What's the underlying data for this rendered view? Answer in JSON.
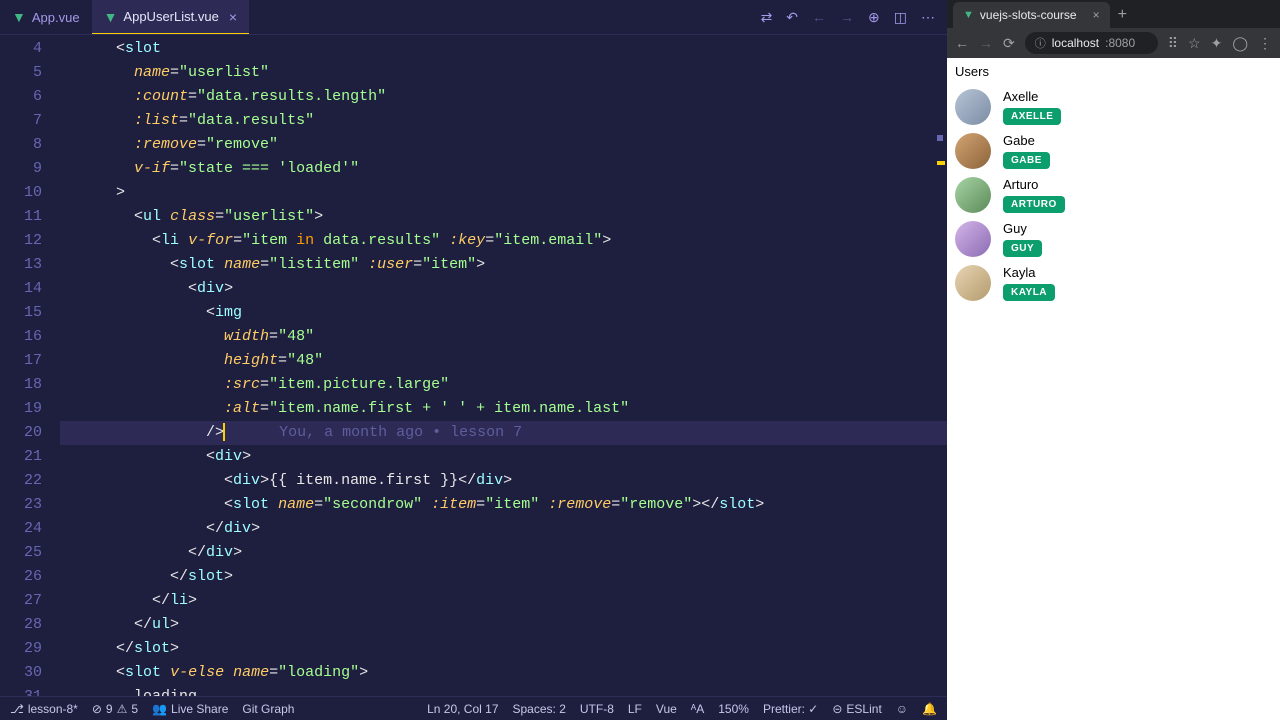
{
  "editor": {
    "tabs": [
      {
        "label": "App.vue",
        "active": false
      },
      {
        "label": "AppUserList.vue",
        "active": true
      }
    ],
    "gutter_start": 4,
    "gutter_end": 31,
    "code_lines": [
      {
        "indent": 2,
        "tokens": [
          [
            "punct",
            "<"
          ],
          [
            "tag-name",
            "slot"
          ]
        ]
      },
      {
        "indent": 3,
        "tokens": [
          [
            "attr",
            "name"
          ],
          [
            "punct",
            "="
          ],
          [
            "string",
            "\"userlist\""
          ]
        ]
      },
      {
        "indent": 3,
        "tokens": [
          [
            "attr",
            ":count"
          ],
          [
            "punct",
            "="
          ],
          [
            "string",
            "\"data.results.length\""
          ]
        ]
      },
      {
        "indent": 3,
        "tokens": [
          [
            "attr",
            ":list"
          ],
          [
            "punct",
            "="
          ],
          [
            "string",
            "\"data.results\""
          ]
        ]
      },
      {
        "indent": 3,
        "tokens": [
          [
            "attr",
            ":remove"
          ],
          [
            "punct",
            "="
          ],
          [
            "string",
            "\"remove\""
          ]
        ]
      },
      {
        "indent": 3,
        "tokens": [
          [
            "attr",
            "v-if"
          ],
          [
            "punct",
            "="
          ],
          [
            "string",
            "\"state === 'loaded'\""
          ]
        ]
      },
      {
        "indent": 2,
        "tokens": [
          [
            "punct",
            ">"
          ]
        ]
      },
      {
        "indent": 3,
        "tokens": [
          [
            "punct",
            "<"
          ],
          [
            "tag-name",
            "ul"
          ],
          [
            "text",
            " "
          ],
          [
            "attr",
            "class"
          ],
          [
            "punct",
            "="
          ],
          [
            "string",
            "\"userlist\""
          ],
          [
            "punct",
            ">"
          ]
        ]
      },
      {
        "indent": 4,
        "tokens": [
          [
            "punct",
            "<"
          ],
          [
            "tag-name",
            "li"
          ],
          [
            "text",
            " "
          ],
          [
            "attr",
            "v-for"
          ],
          [
            "punct",
            "="
          ],
          [
            "string",
            "\"item "
          ],
          [
            "operator",
            "in"
          ],
          [
            "string",
            " data.results\""
          ],
          [
            "text",
            " "
          ],
          [
            "attr",
            ":key"
          ],
          [
            "punct",
            "="
          ],
          [
            "string",
            "\"item.email\""
          ],
          [
            "punct",
            ">"
          ]
        ]
      },
      {
        "indent": 5,
        "tokens": [
          [
            "punct",
            "<"
          ],
          [
            "tag-name",
            "slot"
          ],
          [
            "text",
            " "
          ],
          [
            "attr",
            "name"
          ],
          [
            "punct",
            "="
          ],
          [
            "string",
            "\"listitem\""
          ],
          [
            "text",
            " "
          ],
          [
            "attr",
            ":user"
          ],
          [
            "punct",
            "="
          ],
          [
            "string",
            "\"item\""
          ],
          [
            "punct",
            ">"
          ]
        ]
      },
      {
        "indent": 6,
        "tokens": [
          [
            "punct",
            "<"
          ],
          [
            "tag-name",
            "div"
          ],
          [
            "punct",
            ">"
          ]
        ]
      },
      {
        "indent": 7,
        "tokens": [
          [
            "punct",
            "<"
          ],
          [
            "tag-name",
            "img"
          ]
        ]
      },
      {
        "indent": 8,
        "tokens": [
          [
            "attr",
            "width"
          ],
          [
            "punct",
            "="
          ],
          [
            "string",
            "\"48\""
          ]
        ]
      },
      {
        "indent": 8,
        "tokens": [
          [
            "attr",
            "height"
          ],
          [
            "punct",
            "="
          ],
          [
            "string",
            "\"48\""
          ]
        ]
      },
      {
        "indent": 8,
        "tokens": [
          [
            "attr",
            ":src"
          ],
          [
            "punct",
            "="
          ],
          [
            "string",
            "\"item.picture.large\""
          ]
        ]
      },
      {
        "indent": 8,
        "tokens": [
          [
            "attr",
            ":alt"
          ],
          [
            "punct",
            "="
          ],
          [
            "string",
            "\"item.name.first + ' ' + item.name.last\""
          ]
        ]
      },
      {
        "indent": 7,
        "tokens": [
          [
            "punct",
            "/>"
          ]
        ],
        "highlighted": true,
        "cursor": true,
        "blame": "You, a month ago • lesson 7"
      },
      {
        "indent": 7,
        "tokens": [
          [
            "punct",
            "<"
          ],
          [
            "tag-name",
            "div"
          ],
          [
            "punct",
            ">"
          ]
        ]
      },
      {
        "indent": 8,
        "tokens": [
          [
            "punct",
            "<"
          ],
          [
            "tag-name",
            "div"
          ],
          [
            "punct",
            ">"
          ],
          [
            "text",
            "{{ item.name.first }}"
          ],
          [
            "punct",
            "</"
          ],
          [
            "tag-name",
            "div"
          ],
          [
            "punct",
            ">"
          ]
        ]
      },
      {
        "indent": 8,
        "tokens": [
          [
            "punct",
            "<"
          ],
          [
            "tag-name",
            "slot"
          ],
          [
            "text",
            " "
          ],
          [
            "attr",
            "name"
          ],
          [
            "punct",
            "="
          ],
          [
            "string",
            "\"secondrow\""
          ],
          [
            "text",
            " "
          ],
          [
            "attr",
            ":item"
          ],
          [
            "punct",
            "="
          ],
          [
            "string",
            "\"item\""
          ],
          [
            "text",
            " "
          ],
          [
            "attr",
            ":remove"
          ],
          [
            "punct",
            "="
          ],
          [
            "string",
            "\"remove\""
          ],
          [
            "punct",
            "></"
          ],
          [
            "tag-name",
            "slot"
          ],
          [
            "punct",
            ">"
          ]
        ]
      },
      {
        "indent": 7,
        "tokens": [
          [
            "punct",
            "</"
          ],
          [
            "tag-name",
            "div"
          ],
          [
            "punct",
            ">"
          ]
        ]
      },
      {
        "indent": 6,
        "tokens": [
          [
            "punct",
            "</"
          ],
          [
            "tag-name",
            "div"
          ],
          [
            "punct",
            ">"
          ]
        ]
      },
      {
        "indent": 5,
        "tokens": [
          [
            "punct",
            "</"
          ],
          [
            "tag-name",
            "slot"
          ],
          [
            "punct",
            ">"
          ]
        ]
      },
      {
        "indent": 4,
        "tokens": [
          [
            "punct",
            "</"
          ],
          [
            "tag-name",
            "li"
          ],
          [
            "punct",
            ">"
          ]
        ]
      },
      {
        "indent": 3,
        "tokens": [
          [
            "punct",
            "</"
          ],
          [
            "tag-name",
            "ul"
          ],
          [
            "punct",
            ">"
          ]
        ]
      },
      {
        "indent": 2,
        "tokens": [
          [
            "punct",
            "</"
          ],
          [
            "tag-name",
            "slot"
          ],
          [
            "punct",
            ">"
          ]
        ]
      },
      {
        "indent": 2,
        "tokens": [
          [
            "punct",
            "<"
          ],
          [
            "tag-name",
            "slot"
          ],
          [
            "text",
            " "
          ],
          [
            "attr",
            "v-else"
          ],
          [
            "text",
            " "
          ],
          [
            "attr",
            "name"
          ],
          [
            "punct",
            "="
          ],
          [
            "string",
            "\"loading\""
          ],
          [
            "punct",
            ">"
          ]
        ]
      },
      {
        "indent": 3,
        "tokens": [
          [
            "text",
            "loading..."
          ]
        ]
      }
    ]
  },
  "status": {
    "branch": "lesson-8*",
    "issues": "9",
    "warnings": "5",
    "live_share": "Live Share",
    "git_graph": "Git Graph",
    "position": "Ln 20, Col 17",
    "spaces": "Spaces: 2",
    "encoding": "UTF-8",
    "eol": "LF",
    "lang": "Vue",
    "zoom": "150%",
    "prettier": "Prettier: ✓",
    "eslint": "ESLint"
  },
  "browser": {
    "tab_title": "vuejs-slots-course",
    "host": "localhost",
    "port": ":8080",
    "page_title": "Users",
    "users": [
      {
        "name": "Axelle",
        "badge": "AXELLE",
        "avatar_class": "a1"
      },
      {
        "name": "Gabe",
        "badge": "GABE",
        "avatar_class": "a2"
      },
      {
        "name": "Arturo",
        "badge": "ARTURO",
        "avatar_class": "a3"
      },
      {
        "name": "Guy",
        "badge": "GUY",
        "avatar_class": "a4"
      },
      {
        "name": "Kayla",
        "badge": "KAYLA",
        "avatar_class": "a5"
      }
    ]
  }
}
